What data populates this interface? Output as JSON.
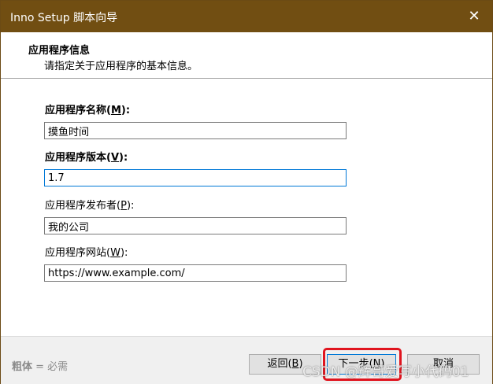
{
  "window": {
    "title": "Inno Setup 脚本向导",
    "close_glyph": "✕"
  },
  "header": {
    "title": "应用程序信息",
    "subtitle": "请指定关于应用程序的基本信息。"
  },
  "form": {
    "name": {
      "label": "应用程序名称",
      "accel": "M",
      "suffix": ":",
      "value": "摸鱼时间",
      "required": true
    },
    "version": {
      "label": "应用程序版本",
      "accel": "V",
      "suffix": ":",
      "value": "1.7",
      "required": true
    },
    "publisher": {
      "label": "应用程序发布者",
      "accel": "P",
      "suffix": ":",
      "value": "我的公司",
      "required": false
    },
    "website": {
      "label": "应用程序网站",
      "accel": "W",
      "suffix": ":",
      "value": "https://www.example.com/",
      "required": false
    }
  },
  "footer": {
    "legend_bold": "粗体",
    "legend_rest": " = 必需",
    "back_label": "返回",
    "back_accel": "B",
    "next_label": "下一步",
    "next_accel": "N",
    "cancel_label": "取消"
  },
  "annotations": {
    "highlight_color": "#e0141e"
  },
  "watermark": {
    "text": "CSDN @辉哥爱写小代码01"
  }
}
